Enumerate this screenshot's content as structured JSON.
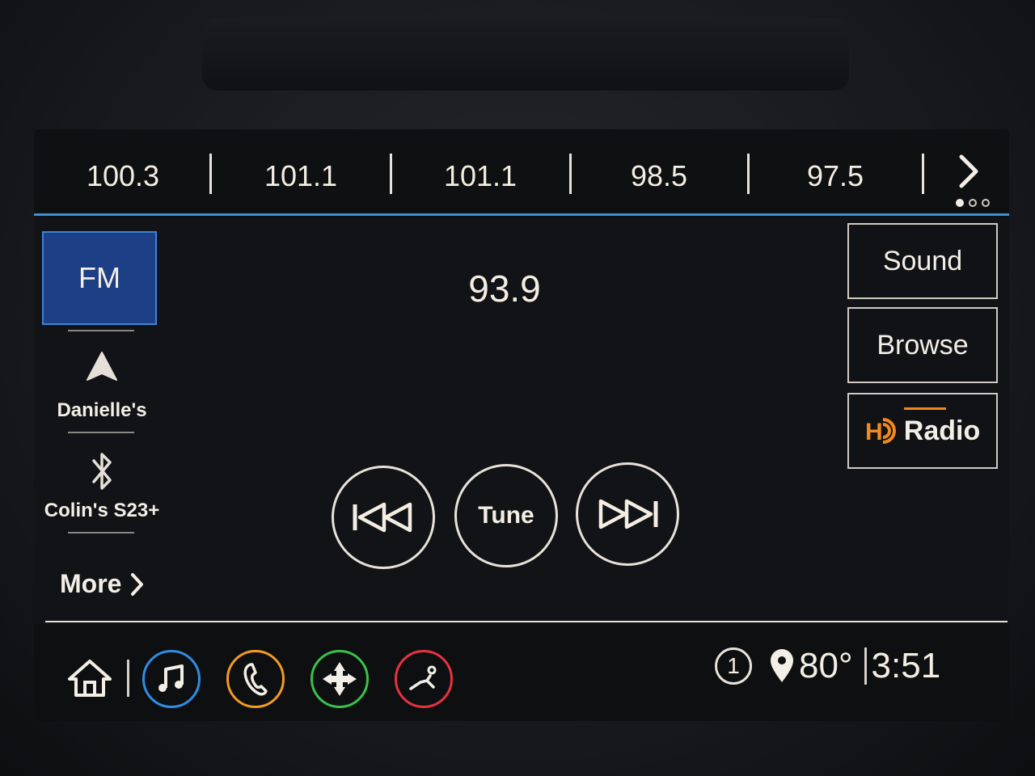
{
  "presets": [
    "100.3",
    "101.1",
    "101.1",
    "98.5",
    "97.5"
  ],
  "sources": {
    "fm": "FM",
    "device1": "Danielle's",
    "device2": "Colin's S23+",
    "more": "More"
  },
  "station": "93.9",
  "controls": {
    "tune": "Tune"
  },
  "right": {
    "sound": "Sound",
    "browse": "Browse",
    "hd_radio": "Radio"
  },
  "status": {
    "info": "1",
    "temperature": "80°",
    "time": "3:51"
  },
  "colors": {
    "accent_blue": "#3d8fd6",
    "fm_bg": "#1c3f85",
    "music_ring": "#2f8de4",
    "phone_ring": "#f39a22",
    "nav_ring": "#39c14a",
    "seat_ring": "#e53340",
    "hd_orange": "#f08a1c"
  },
  "icons": [
    "home-icon",
    "music-note-icon",
    "phone-icon",
    "navigation-icon",
    "seat-icon",
    "location-pin-icon",
    "bluetooth-icon",
    "arrow-up-icon"
  ]
}
